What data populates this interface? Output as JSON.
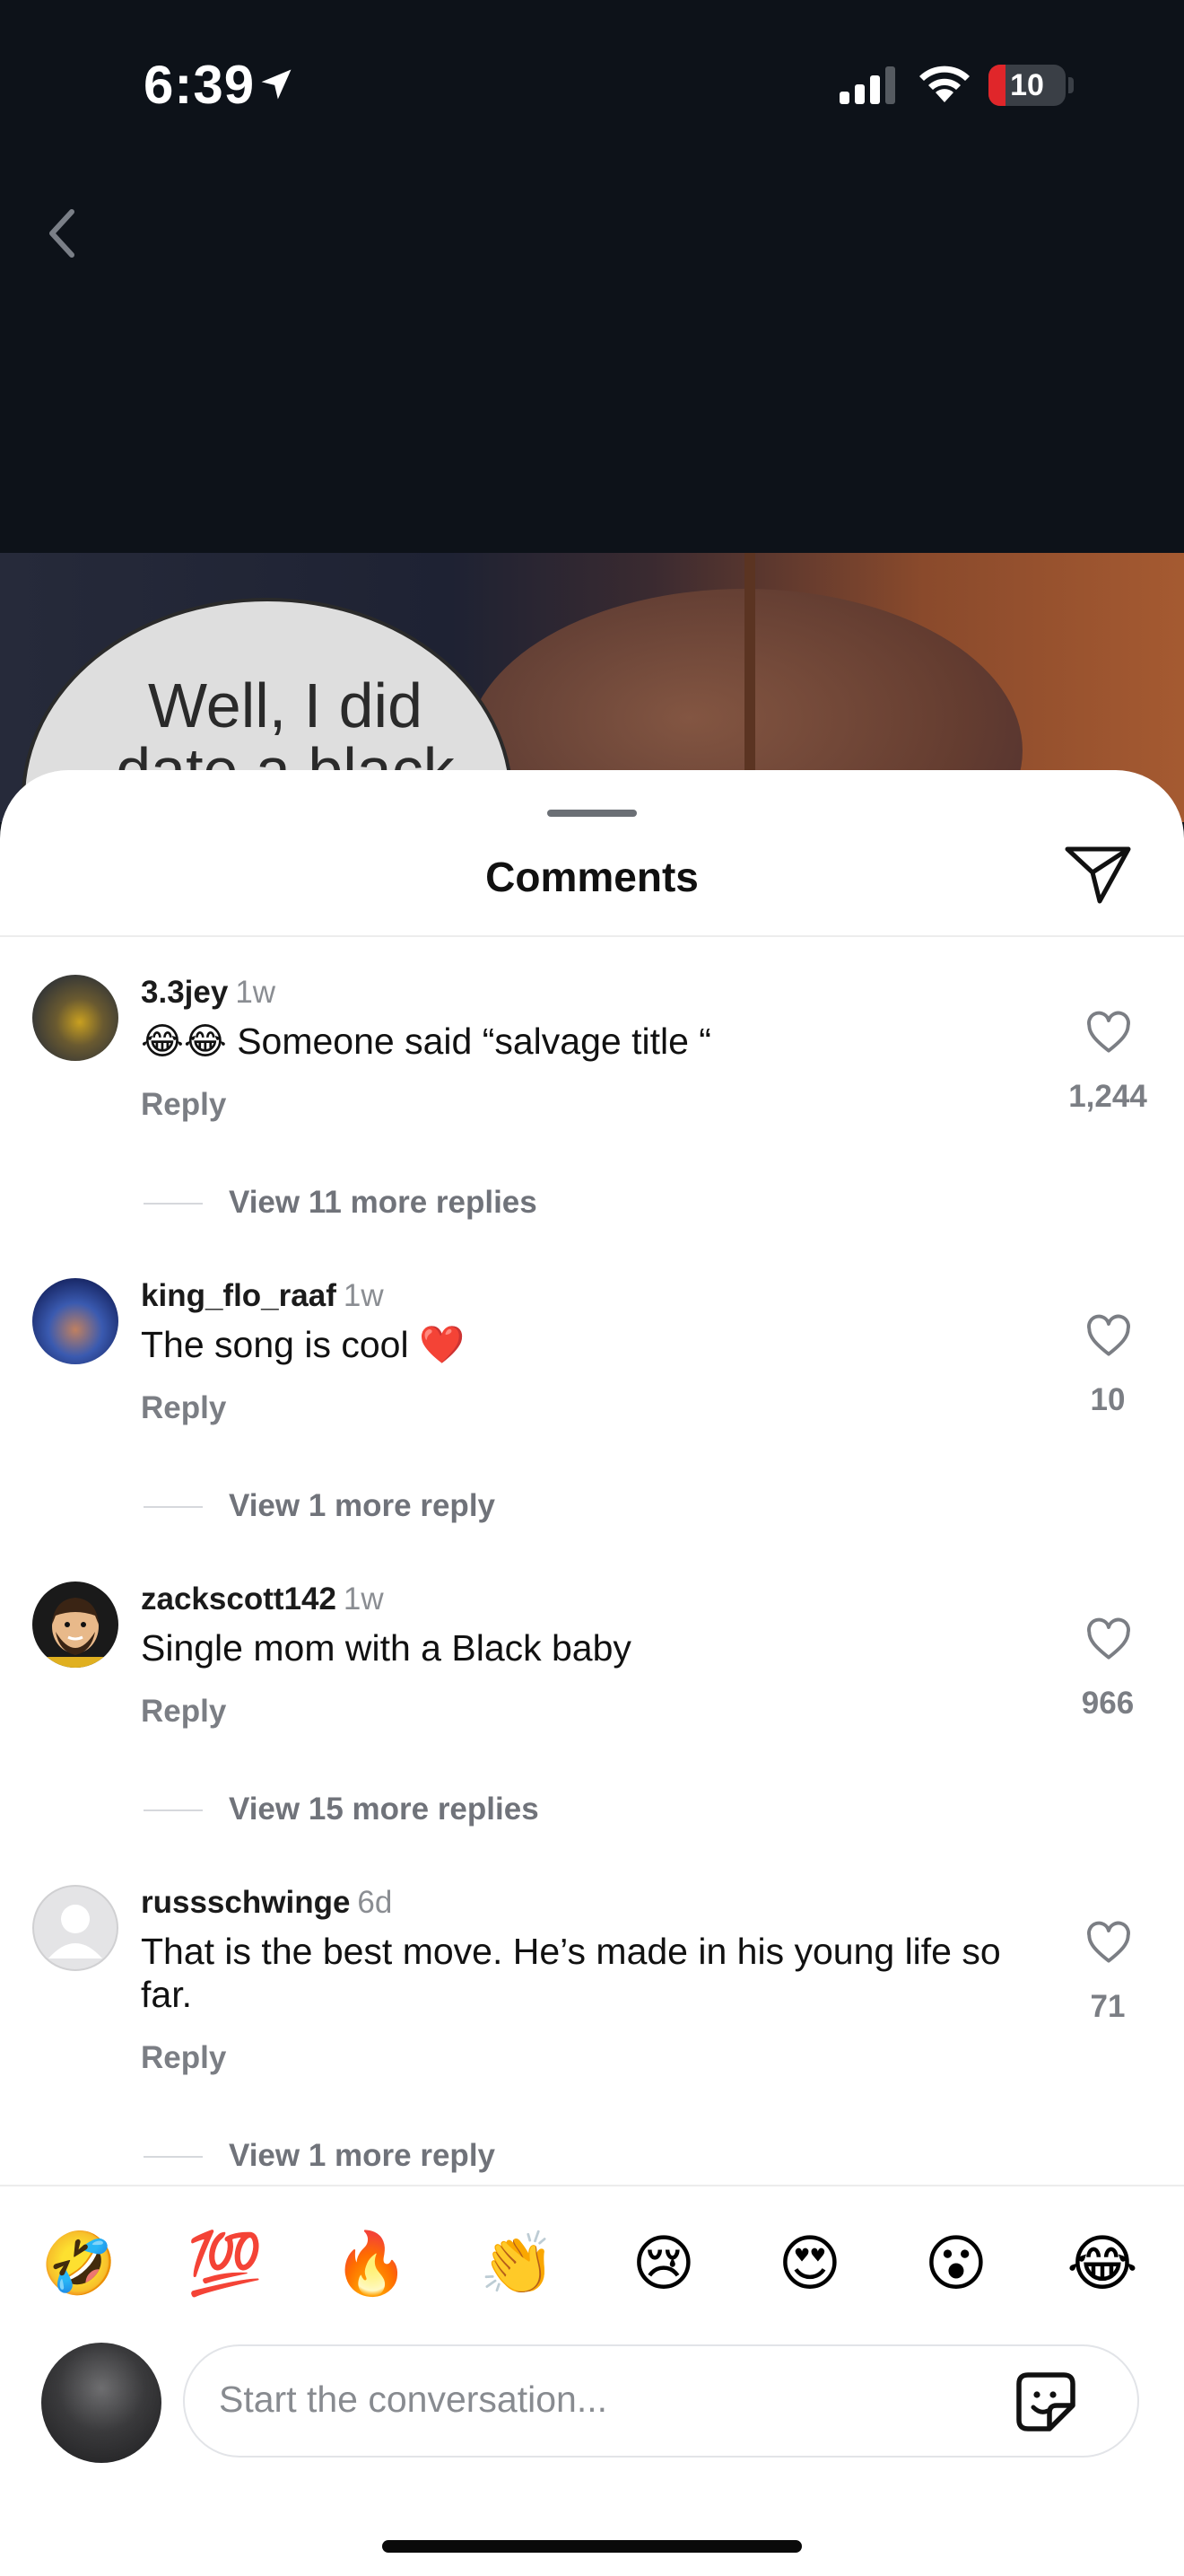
{
  "status_bar": {
    "time": "6:39",
    "battery": "10",
    "battery_level": 0.1,
    "signal_bars": 3
  },
  "nav": {
    "back_icon": "chevron-left-icon"
  },
  "video": {
    "bubble_text": "Well, I did\ndate a black"
  },
  "sheet": {
    "title": "Comments",
    "share_icon": "send-icon"
  },
  "comments": [
    {
      "author": "3.3jey",
      "time": "1w",
      "text": "😂😂 Someone said “salvage title “",
      "reply": "Reply",
      "likes": "1,244",
      "view_replies": "View 11 more replies"
    },
    {
      "author": "king_flo_raaf",
      "time": "1w",
      "text": "The song is cool ❤️",
      "reply": "Reply",
      "likes": "10",
      "view_replies": "View 1 more reply"
    },
    {
      "author": "zackscott142",
      "time": "1w",
      "text": "Single mom with a Black baby",
      "reply": "Reply",
      "likes": "966",
      "view_replies": "View 15 more replies"
    },
    {
      "author": "russschwinge",
      "time": "6d",
      "text": "That is the best move. He’s made in his young life so far.",
      "reply": "Reply",
      "likes": "71",
      "view_replies": "View 1 more reply"
    }
  ],
  "emoji_bar": [
    "🤣",
    "💯",
    "🔥",
    "👏",
    "😢",
    "😍",
    "😮",
    "😂"
  ],
  "composer": {
    "placeholder": "Start the conversation...",
    "sticker_icon": "sticker-icon"
  },
  "colors": {
    "sheet_bg": "#ffffff",
    "screen_bg": "#0d1219",
    "muted_text": "#7b7e84",
    "battery_low": "#e0262a"
  }
}
